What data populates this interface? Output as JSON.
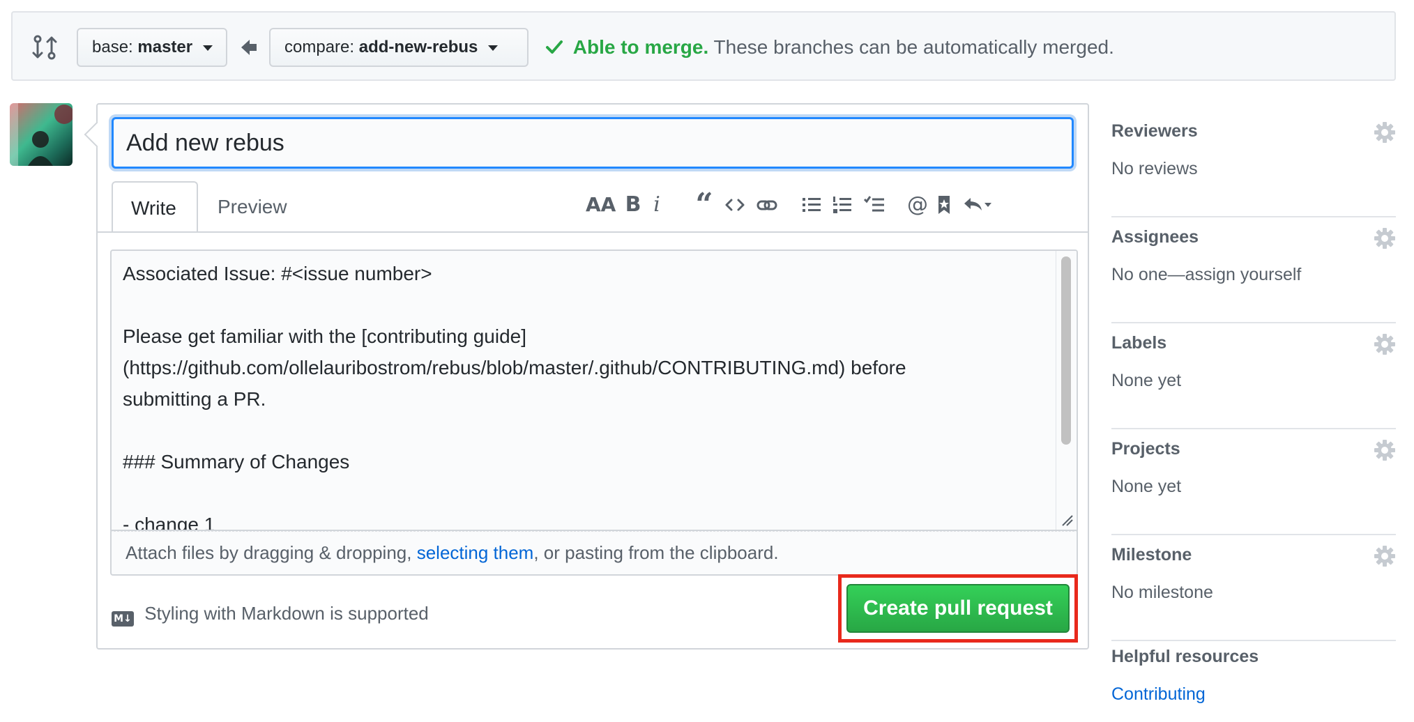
{
  "compare_bar": {
    "base_prefix": "base:",
    "base_branch": "master",
    "compare_prefix": "compare:",
    "compare_branch": "add-new-rebus",
    "merge_ok": "Able to merge.",
    "merge_desc": "These branches can be automatically merged.",
    "status_color": "#28a745"
  },
  "form": {
    "title_value": "Add new rebus",
    "tabs": [
      {
        "label": "Write",
        "active": true
      },
      {
        "label": "Preview",
        "active": false
      }
    ],
    "toolbar_icons": [
      "header-icon",
      "bold-icon",
      "italic-icon",
      "quote-icon",
      "code-icon",
      "link-icon",
      "unordered-list-icon",
      "ordered-list-icon",
      "task-list-icon",
      "mention-icon",
      "reference-icon",
      "saved-replies-icon"
    ],
    "body_text": "Associated Issue: #<issue number>\n\nPlease get familiar with the [contributing guide]\n(https://github.com/ollelauribostrom/rebus/blob/master/.github/CONTRIBUTING.md) before\nsubmitting a PR.\n\n### Summary of Changes\n\n- change 1",
    "attach_before": "Attach files by dragging & dropping, ",
    "attach_link": "selecting them",
    "attach_after": ", or pasting from the clipboard.",
    "markdown_note": "Styling with Markdown is supported",
    "submit_label": "Create pull request",
    "accent_color": "#0366d6",
    "submit_color": "#28a745"
  },
  "sidebar": {
    "sections": [
      {
        "title": "Reviewers",
        "value": "No reviews"
      },
      {
        "title": "Assignees",
        "value": "No one—assign yourself"
      },
      {
        "title": "Labels",
        "value": "None yet"
      },
      {
        "title": "Projects",
        "value": "None yet"
      },
      {
        "title": "Milestone",
        "value": "No milestone"
      }
    ],
    "resources_title": "Helpful resources",
    "resources_link": "Contributing"
  }
}
